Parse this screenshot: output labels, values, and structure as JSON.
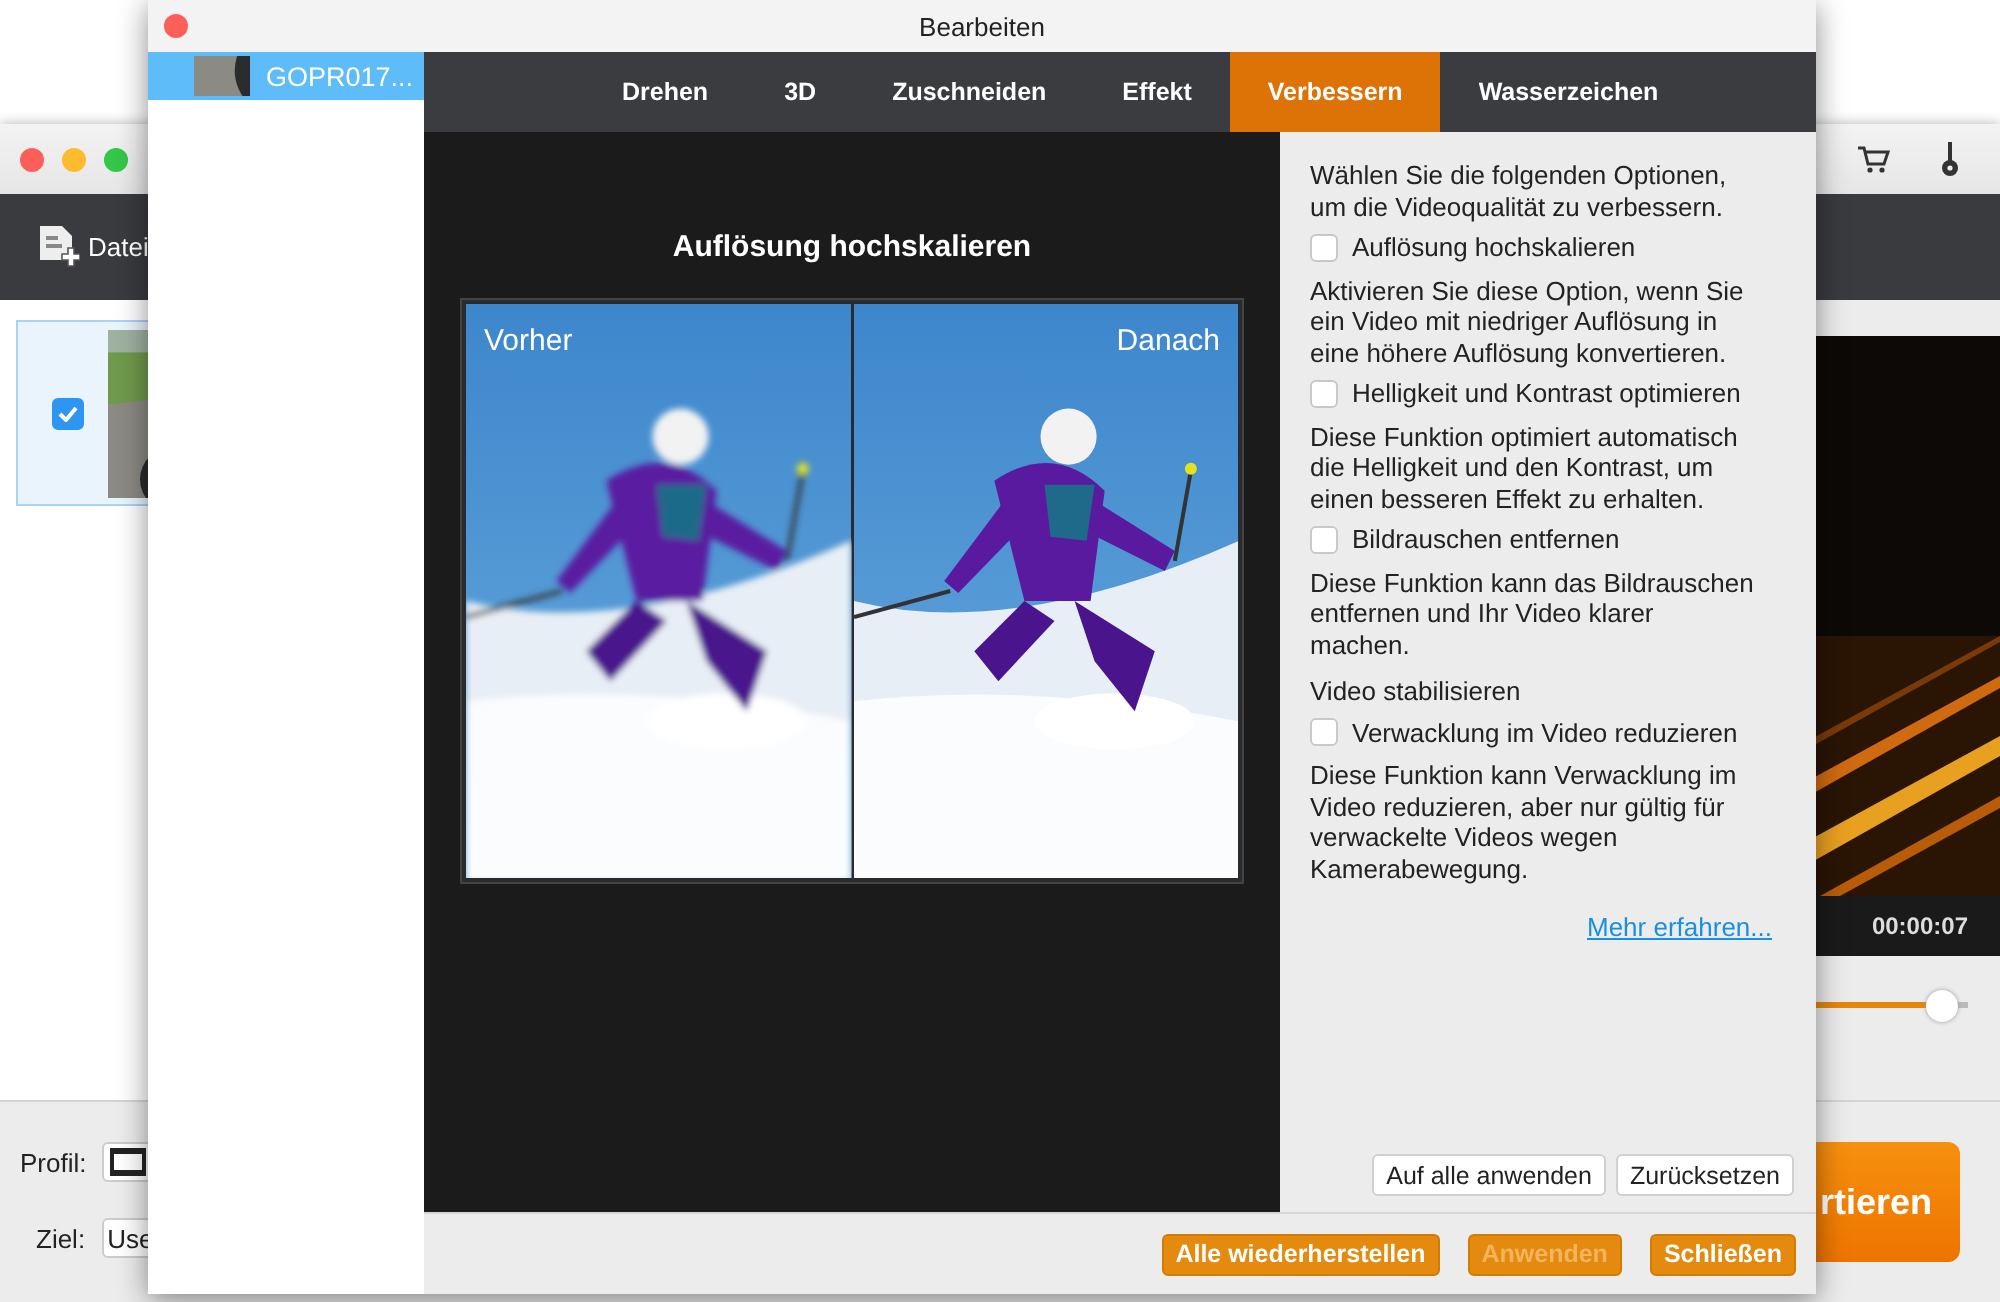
{
  "main_window": {
    "toolbar": {
      "file_button": "Datei"
    },
    "file_list": [
      {
        "checked": true,
        "kind": "picture"
      }
    ],
    "player": {
      "time": "00:00:07",
      "volume": {
        "level": 0.95
      }
    },
    "profile": {
      "label": "Profil:"
    },
    "destination": {
      "label": "Ziel:",
      "value": "Use"
    },
    "convert_button": "rtieren"
  },
  "dialog": {
    "title": "Bearbeiten",
    "files": [
      {
        "name": "GOPR017...",
        "selected": true
      }
    ],
    "tabs": [
      {
        "label": "Drehen",
        "selected": false
      },
      {
        "label": "3D",
        "selected": false
      },
      {
        "label": "Zuschneiden",
        "selected": false
      },
      {
        "label": "Effekt",
        "selected": false
      },
      {
        "label": "Verbessern",
        "selected": true
      },
      {
        "label": "Wasserzeichen",
        "selected": false
      }
    ],
    "preview": {
      "heading": "Auflösung hochskalieren",
      "before_label": "Vorher",
      "after_label": "Danach"
    },
    "options": [
      {
        "kind": "text",
        "text": "Wählen Sie die folgenden Optionen, um die Videoqualität zu verbessern."
      },
      {
        "kind": "checkbox",
        "label": "Auflösung hochskalieren",
        "checked": false
      },
      {
        "kind": "text",
        "text": "Aktivieren Sie diese Option, wenn Sie ein Video mit niedriger Auflösung in eine höhere Auflösung konvertieren."
      },
      {
        "kind": "checkbox",
        "label": "Helligkeit und Kontrast optimieren",
        "checked": false
      },
      {
        "kind": "text",
        "text": "Diese Funktion optimiert automatisch die Helligkeit und den Kontrast, um einen besseren Effekt zu erhalten."
      },
      {
        "kind": "checkbox",
        "label": "Bildrauschen entfernen",
        "checked": false
      },
      {
        "kind": "text",
        "text": "Diese Funktion kann das Bildrauschen entfernen und Ihr Video klarer machen."
      },
      {
        "kind": "heading",
        "text": "Video stabilisieren"
      },
      {
        "kind": "checkbox",
        "label": "Verwacklung im Video reduzieren",
        "checked": false
      },
      {
        "kind": "text",
        "text": "Diese Funktion kann Verwacklung im Video reduzieren, aber nur gültig für verwackelte Videos wegen Kamerabewegung."
      },
      {
        "kind": "link",
        "text": "Mehr erfahren..."
      }
    ],
    "panel_buttons": [
      "Auf alle anwenden",
      "Zurücksetzen"
    ],
    "footer_buttons": [
      {
        "label": "Alle wiederherstellen",
        "disabled": false
      },
      {
        "label": "Anwenden",
        "disabled": true
      },
      {
        "label": "Schließen",
        "disabled": false
      }
    ]
  }
}
